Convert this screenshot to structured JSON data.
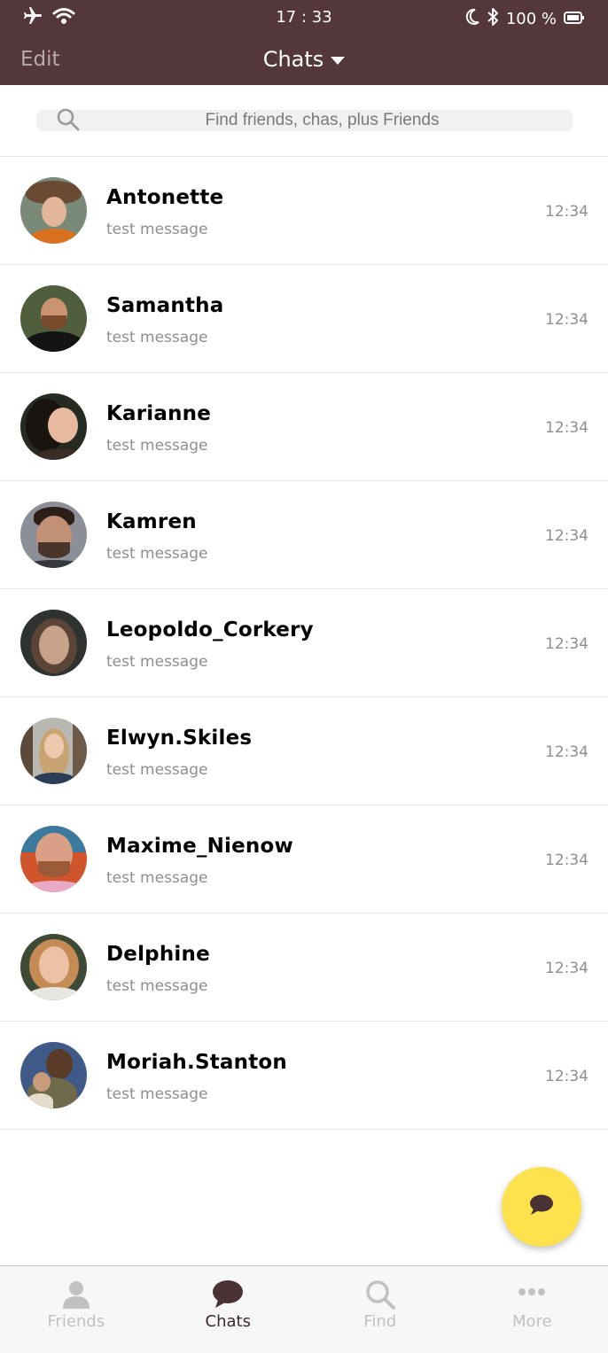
{
  "status_bar": {
    "time": "17 : 33",
    "battery": "100 %"
  },
  "nav": {
    "edit": "Edit",
    "title": "Chats"
  },
  "search": {
    "placeholder": "Find friends, chas, plus Friends"
  },
  "chats": [
    {
      "name": "Antonette",
      "message": "test message",
      "time": "12:34"
    },
    {
      "name": "Samantha",
      "message": "test message",
      "time": "12:34"
    },
    {
      "name": "Karianne",
      "message": "test message",
      "time": "12:34"
    },
    {
      "name": "Kamren",
      "message": "test message",
      "time": "12:34"
    },
    {
      "name": "Leopoldo_Corkery",
      "message": "test message",
      "time": "12:34"
    },
    {
      "name": "Elwyn.Skiles",
      "message": "test message",
      "time": "12:34"
    },
    {
      "name": "Maxime_Nienow",
      "message": "test message",
      "time": "12:34"
    },
    {
      "name": "Delphine",
      "message": "test message",
      "time": "12:34"
    },
    {
      "name": "Moriah.Stanton",
      "message": "test message",
      "time": "12:34"
    }
  ],
  "tabs": [
    {
      "label": "Friends",
      "icon": "person-icon",
      "active": false
    },
    {
      "label": "Chats",
      "icon": "chat-bubble-icon",
      "active": true
    },
    {
      "label": "Find",
      "icon": "search-icon",
      "active": false
    },
    {
      "label": "More",
      "icon": "more-dots-icon",
      "active": false
    }
  ],
  "colors": {
    "header_bg": "#54373a",
    "fab_bg": "#fde14d",
    "tab_active": "#3a2a2b",
    "tab_inactive": "#c1c1c1"
  }
}
